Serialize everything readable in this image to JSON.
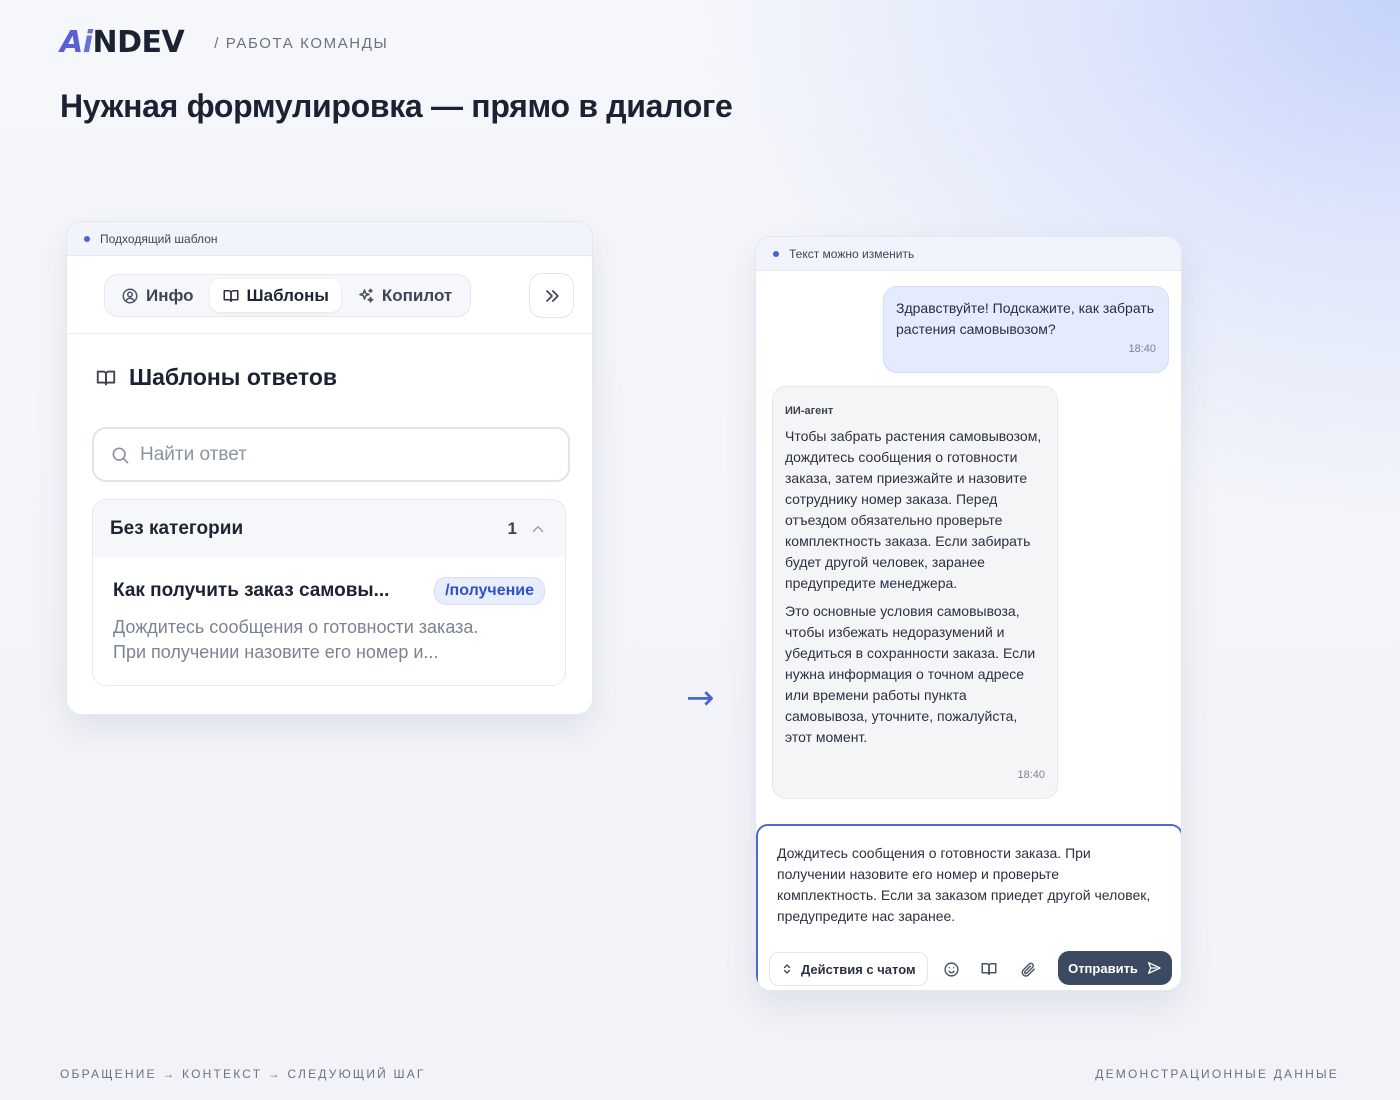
{
  "brand": {
    "logo_a": "A",
    "logo_i": "i",
    "logo_rest": "NDEV",
    "section": "/ РАБОТА КОМАНДЫ"
  },
  "page_title": "Нужная формулировка — прямо в диалоге",
  "colors": {
    "accent": "#4a63d6",
    "tag_bg": "#e7edfb",
    "tag_text": "#2f53c7",
    "user_bubble": "#e3ebfd",
    "send_button": "#3c4a61"
  },
  "left_card": {
    "header": "Подходящий шаблон",
    "tabs": [
      {
        "label": "Инфо",
        "icon": "user-circle-icon"
      },
      {
        "label": "Шаблоны",
        "icon": "book-icon"
      },
      {
        "label": "Копилот",
        "icon": "sparkles-icon"
      }
    ],
    "active_tab": "Шаблоны",
    "expand_icon": "chevrons-right-icon",
    "section_title": "Шаблоны ответов",
    "search_placeholder": "Найти ответ",
    "category": {
      "name": "Без категории",
      "count": "1"
    },
    "template": {
      "title": "Как получить заказ самовы...",
      "tag": "/получение",
      "desc_line1": "Дождитесь сообщения о готовности заказа.",
      "desc_line2": "При получении назовите его номер и..."
    }
  },
  "arrow": "→",
  "right_card": {
    "header": "Текст можно изменить",
    "user_message": {
      "text": "Здравствуйте! Подскажите, как забрать растения самовывозом?",
      "time": "18:40"
    },
    "agent_message": {
      "author": "ИИ-агент",
      "p1": "Чтобы забрать растения самовывозом, дождитесь сообщения о готовности заказа, затем приезжайте и назовите сотруднику номер заказа. Перед отъездом обязательно проверьте комплектность заказа. Если забирать будет другой человек, заранее предупредите менеджера.",
      "p2": "Это основные условия самовывоза, чтобы избежать недоразумений и убедиться в сохранности заказа. Если нужна информация о точном адресе или времени работы пункта самовывоза, уточните, пожалуйста, этот момент.",
      "time": "18:40"
    },
    "composer": {
      "text": "Дождитесь сообщения о готовности заказа. При получении назовите его номер и проверьте комплектность. Если за заказом приедет другой человек, предупредите нас заранее.",
      "actions_label": "Действия с чатом",
      "send_label": "Отправить"
    }
  },
  "footer": {
    "left": "ОБРАЩЕНИЕ → КОНТЕКСТ → СЛЕДУЮЩИЙ ШАГ",
    "right": "ДЕМОНСТРАЦИОННЫЕ ДАННЫЕ"
  }
}
